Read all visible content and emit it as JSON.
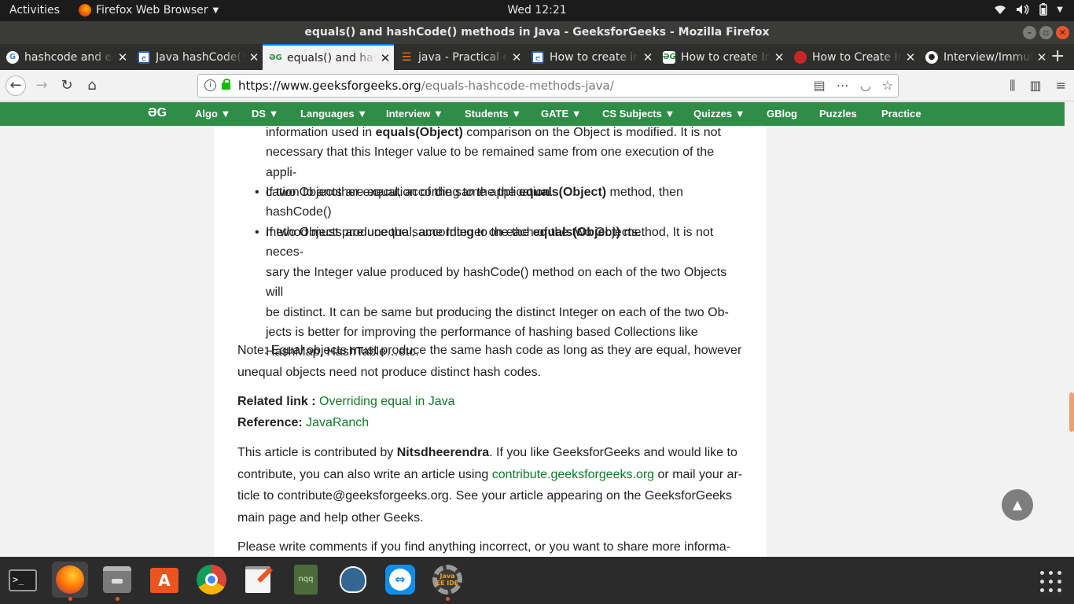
{
  "topbar": {
    "activities": "Activities",
    "app_name": "Firefox Web Browser",
    "clock": "Wed 12:21"
  },
  "window": {
    "title": "equals() and hashCode() methods in Java - GeeksforGeeks - Mozilla Firefox"
  },
  "tabs": [
    {
      "label": "hashcode and equals",
      "icon": "google-icon",
      "active": false
    },
    {
      "label": "Java hashCode()",
      "icon": "doc-icon",
      "active": false
    },
    {
      "label": "equals() and hashCode()",
      "icon": "gfg-icon",
      "active": true
    },
    {
      "label": "java - Practical example",
      "icon": "stackoverflow-icon",
      "active": false
    },
    {
      "label": "How to create immutable",
      "icon": "doc-icon",
      "active": false
    },
    {
      "label": "How to create Immutable",
      "icon": "gfg-icon",
      "active": false
    },
    {
      "label": "How to Create Immutable",
      "icon": "red-circle-icon",
      "active": false
    },
    {
      "label": "Interview/Immutable",
      "icon": "github-icon",
      "active": false
    }
  ],
  "navbar": {
    "url_host": "https://www.geeksforgeeks.org",
    "url_path": "/equals-hashcode-methods-java/"
  },
  "gfgnav": {
    "logo": "ƏG",
    "items": [
      "Algo ▼",
      "DS ▼",
      "Languages ▼",
      "Interview ▼",
      "Students ▼",
      "GATE ▼",
      "CS Subjects ▼",
      "Quizzes ▼",
      "GBlog",
      "Puzzles",
      "Practice"
    ]
  },
  "article": {
    "b1_l1_pre": "information used in ",
    "b1_l1_bold": "equals(Object)",
    "b1_l1_post": " comparison on the Object is modified. It is not",
    "b1_l2": "necessary that this Integer value to be remained same from one execution of the appli-",
    "b1_l3": "cation to another execution of the same application.",
    "b2_l1_pre": "If two Objects are equal, according to the the ",
    "b2_l1_bold": "equals(Object)",
    "b2_l1_post": " method, then hashCode()",
    "b2_l2": "method must produce the same Integer on each of the two Objects.",
    "b3_l1_pre": "If two Objects are unequal, according to the the ",
    "b3_l1_bold": "equals(Object)",
    "b3_l1_post": " method, It is not neces-",
    "b3_l2": "sary the Integer value produced by hashCode() method on each of the two Objects will",
    "b3_l3": "be distinct. It can be same but producing the distinct Integer on each of the two Ob-",
    "b3_l4": "jects is better for improving the performance of hashing based Collections like",
    "b3_l5": "HashMap, HashTable…etc.",
    "note_l1": "Note: Equal objects must produce the same hash code as long as they are equal, however",
    "note_l2": "unequal objects need not produce distinct hash codes.",
    "related_label": "Related link : ",
    "related_link": "Overriding equal in Java",
    "reference_label": "Reference: ",
    "reference_link": "JavaRanch",
    "contrib_l1_pre": "This article is contributed by ",
    "contrib_author": "Nitsdheerendra",
    "contrib_l1_post": ". If you like GeeksforGeeks and would like to",
    "contrib_l2_pre": "contribute, you can also write an article using ",
    "contrib_link": "contribute.geeksforgeeks.org",
    "contrib_l2_post": " or mail your ar-",
    "contrib_l3": "ticle to contribute@geeksforgeeks.org. See your article appearing on the GeeksforGeeks",
    "contrib_l4": "main page and help other Geeks.",
    "comments_l1": "Please write comments if you find anything incorrect, or you want to share more informa-"
  },
  "back_to_top": "▲",
  "dock": {
    "items": [
      "terminal-icon",
      "firefox-icon",
      "files-icon",
      "software-center-icon",
      "chrome-icon",
      "text-editor-icon",
      "nqq-icon",
      "pgadmin-icon",
      "teamviewer-icon",
      "java-ee-ide-icon"
    ],
    "nqq_label": "nqq",
    "javaee_label": "Java EE IDE"
  },
  "colors": {
    "gfg_green": "#2f8d46",
    "link_green": "#0e7a27",
    "ubuntu_orange": "#e95420"
  }
}
